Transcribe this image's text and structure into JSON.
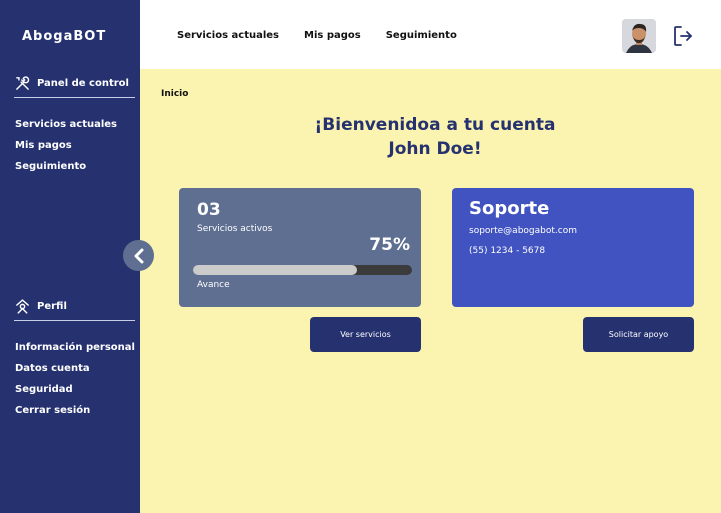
{
  "brand": {
    "name": "AbogaBOT"
  },
  "sidebar": {
    "panel_label": "Panel de control",
    "panel_items": [
      {
        "label": "Servicios actuales"
      },
      {
        "label": "Mis pagos"
      },
      {
        "label": "Seguimiento"
      }
    ],
    "profile_label": "Perfil",
    "profile_items": [
      {
        "label": "Información personal"
      },
      {
        "label": "Datos cuenta"
      },
      {
        "label": "Seguridad"
      },
      {
        "label": "Cerrar sesión"
      }
    ]
  },
  "topnav": {
    "items": [
      {
        "label": "Servicios actuales"
      },
      {
        "label": "Mis pagos"
      },
      {
        "label": "Seguimiento"
      }
    ]
  },
  "breadcrumb": "Inicio",
  "welcome": {
    "line1": "¡Bienvenidoa a tu cuenta",
    "line2": "John Doe!"
  },
  "stats_card": {
    "count": "03",
    "count_label": "Servicios activos",
    "progress_text": "75%",
    "progress_value": 0.75,
    "progress_label": "Avance"
  },
  "support_card": {
    "title": "Soporte",
    "email": "soporte@abogabot.com",
    "phone": "(55) 1234 - 5678"
  },
  "buttons": {
    "services": "Ver servicios",
    "support": "Solicitar apoyo"
  },
  "colors": {
    "sidebar": "#263270",
    "background": "#fbf4b0",
    "stats_card": "#5f6f92",
    "support_card": "#4053c0"
  },
  "icons": {
    "panel": "tools-icon",
    "profile": "profile-icon",
    "collapse": "chevron-left-icon",
    "logout": "logout-icon"
  }
}
